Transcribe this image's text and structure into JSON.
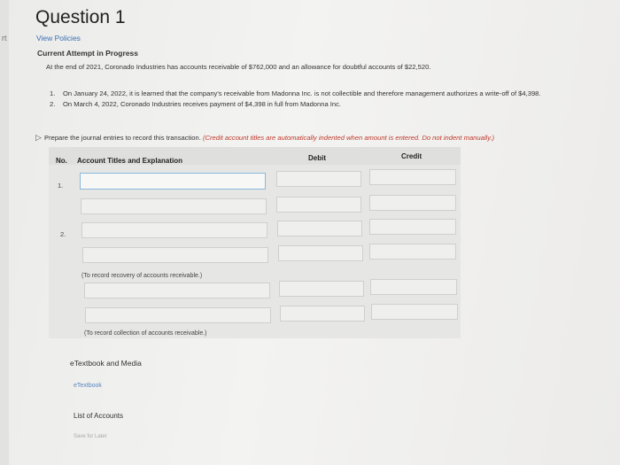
{
  "left_edge_text": "rt",
  "header": {
    "title": "Question 1",
    "view_policies": "View Policies",
    "attempt_status": "Current Attempt in Progress"
  },
  "problem": {
    "statement": "At the end of 2021, Coronado Industries has accounts receivable of $762,000 and an allowance for doubtful accounts of $22,520.",
    "items": [
      {
        "num": "1.",
        "text": "On January 24, 2022, it is learned that the company's receivable from Madonna Inc. is not collectible and therefore management authorizes a write-off of $4,398."
      },
      {
        "num": "2.",
        "text": "On March 4, 2022, Coronado Industries receives payment of $4,398 in full from Madonna Inc."
      }
    ]
  },
  "instructions": {
    "prompt": "Prepare the journal entries to record this transaction.",
    "note": "(Credit account titles are automatically indented when amount is entered. Do not indent manually.)"
  },
  "table": {
    "headers": {
      "no": "No.",
      "account": "Account Titles and Explanation",
      "debit": "Debit",
      "credit": "Credit"
    },
    "row_numbers": [
      "1.",
      "2."
    ],
    "notes": [
      "(To record recovery of accounts receivable.)",
      "(To record collection of accounts receivable.)"
    ]
  },
  "resources": {
    "etextbook_media": "eTextbook and Media",
    "etextbook_link": "eTextbook",
    "list_of_accounts": "List of Accounts",
    "save_for_later": "Save for Later"
  }
}
